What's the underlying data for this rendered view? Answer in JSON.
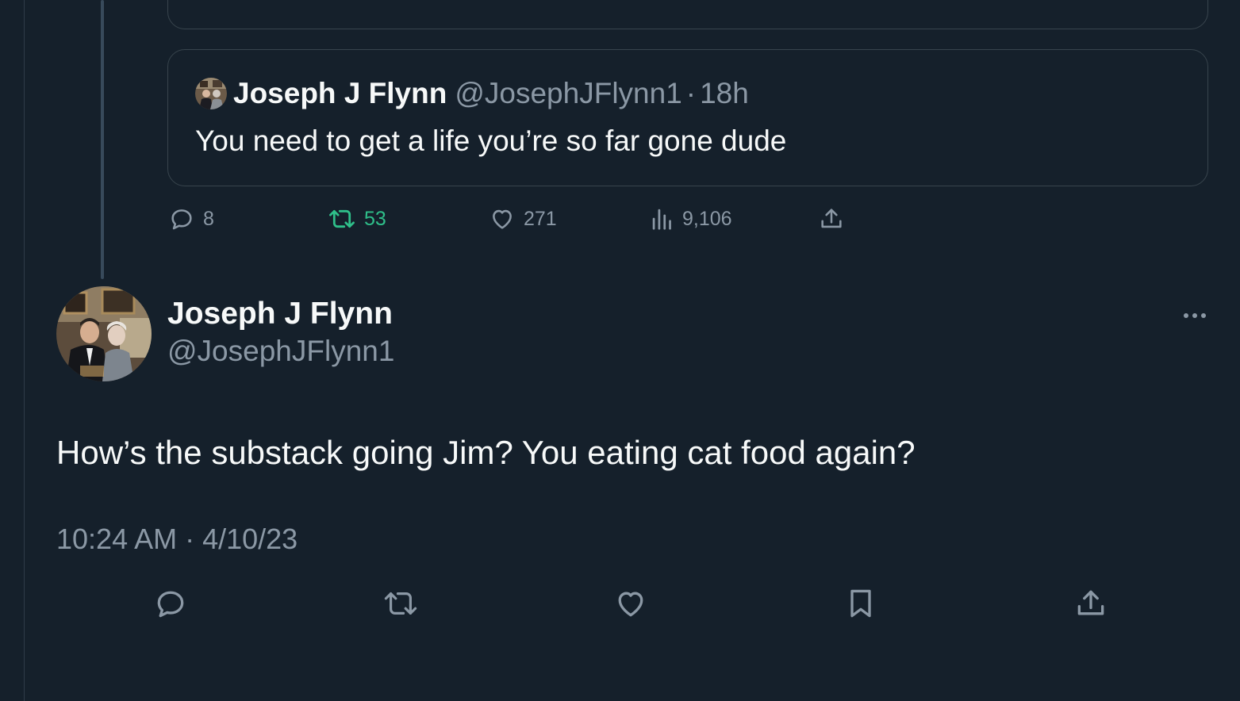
{
  "quoted_tweet": {
    "author_name": "Joseph J Flynn",
    "author_handle": "@JosephJFlynn1",
    "separator": "·",
    "time": "18h",
    "text": "You need to get a life you’re so far gone dude"
  },
  "stats": {
    "replies": "8",
    "retweets": "53",
    "likes": "271",
    "views": "9,106"
  },
  "tweet": {
    "author_name": "Joseph J Flynn",
    "author_handle": "@JosephJFlynn1",
    "text": "How’s the substack going Jim?  You eating cat food again?",
    "timestamp": "10:24 AM · 4/10/23"
  },
  "icons": {
    "reply": "reply-icon",
    "retweet": "retweet-icon",
    "like": "heart-icon",
    "views": "views-icon",
    "share": "share-icon",
    "bookmark": "bookmark-icon",
    "more": "more-icon"
  },
  "colors": {
    "background": "#15202b",
    "text_primary": "#f7f9f9",
    "text_secondary": "#8b98a5",
    "retweet_active": "#2fbf8a",
    "border": "#38444d"
  }
}
